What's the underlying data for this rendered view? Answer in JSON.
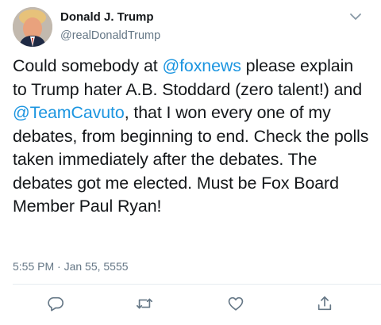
{
  "author": {
    "name": "Donald J. Trump",
    "handle": "@realDonaldTrump"
  },
  "tweet": {
    "segments": [
      {
        "text": "Could somebody at ",
        "type": "text"
      },
      {
        "text": "@foxnews",
        "type": "mention"
      },
      {
        "text": " please explain to Trump hater A.B. Stoddard (zero talent!) and ",
        "type": "text"
      },
      {
        "text": "@TeamCavuto",
        "type": "mention"
      },
      {
        "text": ", that I won every one of my debates, from beginning to end. Check the polls taken immediately after the debates. The debates got me elected. Must be Fox Board Member Paul Ryan!",
        "type": "text"
      }
    ],
    "timestamp": "5:55 PM · Jan 55, 5555"
  },
  "icons": {
    "menu": "chevron-down-icon",
    "reply": "reply-icon",
    "retweet": "retweet-icon",
    "like": "heart-icon",
    "share": "share-icon"
  },
  "colors": {
    "text": "#14171a",
    "secondary": "#657786",
    "link": "#1b95e0",
    "divider": "#e6ecf0"
  }
}
